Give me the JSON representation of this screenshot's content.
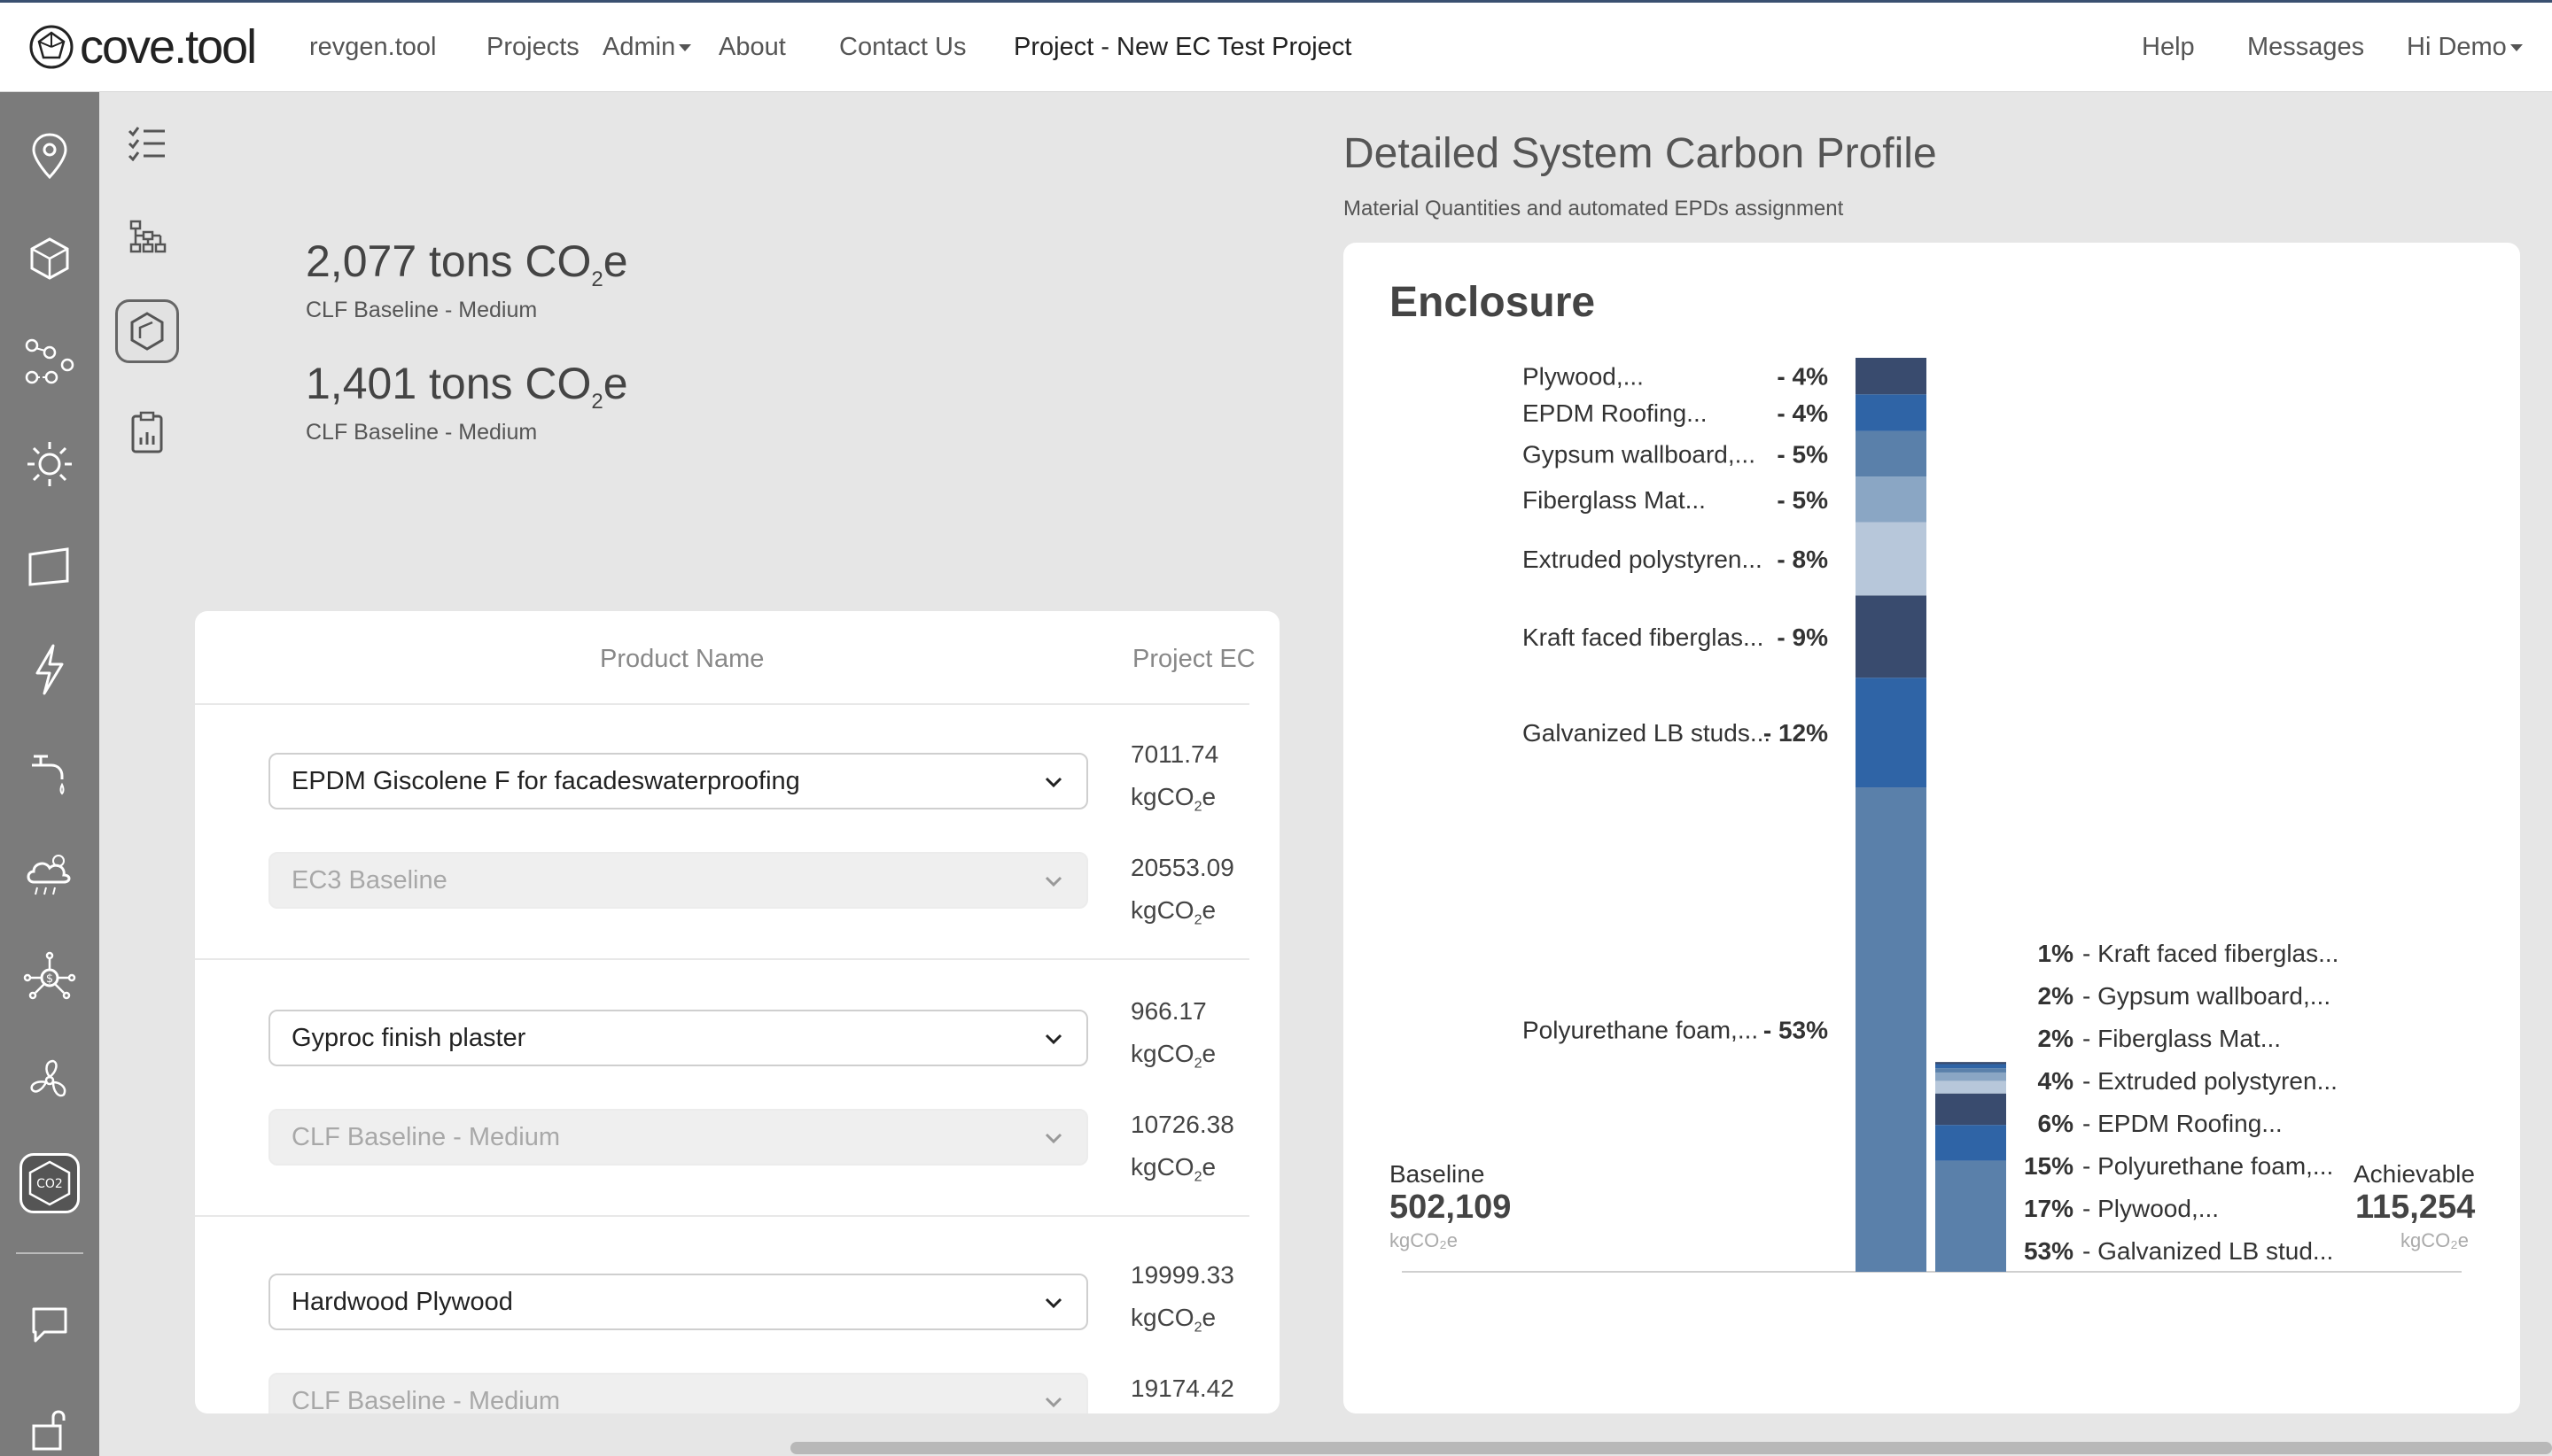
{
  "brand": {
    "logo_text": "cove.tool"
  },
  "nav": {
    "revgen": "revgen.tool",
    "projects": "Projects",
    "admin": "Admin",
    "about": "About",
    "contact": "Contact Us",
    "project_title": "Project - New EC Test Project",
    "help": "Help",
    "messages": "Messages",
    "user": "Hi Demo"
  },
  "sidebar": {
    "co2_label": "CO2"
  },
  "stats": [
    {
      "value": "2,077 tons CO",
      "sub": "2",
      "suffix": "e",
      "label": "CLF Baseline - Medium"
    },
    {
      "value": "1,401 tons CO",
      "sub": "2",
      "suffix": "e",
      "label": "CLF Baseline - Medium"
    }
  ],
  "table": {
    "col_product": "Product Name",
    "col_ec": "Project EC",
    "unit_prefix": "kgCO",
    "unit_sub": "2",
    "unit_suffix": "e",
    "rows": [
      {
        "product": "EPDM Giscolene F for facadeswaterproofing",
        "ec": "7011.74",
        "baseline": "EC3 Baseline",
        "baseline_ec": "20553.09"
      },
      {
        "product": "Gyproc finish plaster",
        "ec": "966.17",
        "baseline": "CLF Baseline - Medium",
        "baseline_ec": "10726.38"
      },
      {
        "product": "Hardwood Plywood",
        "ec": "19999.33",
        "baseline": "CLF Baseline - Medium",
        "baseline_ec": "19174.42"
      }
    ]
  },
  "profile": {
    "title": "Detailed System Carbon Profile",
    "subtitle": "Material Quantities and automated EPDs assignment",
    "card_title": "Enclosure",
    "baseline_label": "Baseline",
    "baseline_value": "502,109",
    "baseline_unit": "kgCO₂e",
    "achievable_label": "Achievable",
    "achievable_value": "115,254",
    "achievable_unit": "kgCO₂e"
  },
  "chart_data": {
    "type": "bar",
    "stacked": true,
    "categories": [
      "Baseline",
      "Achievable"
    ],
    "totals": [
      502109,
      115254
    ],
    "units": "kgCO₂e",
    "baseline_segments": [
      {
        "name": "Polyurethane foam,...",
        "pct": 53,
        "color": "#5a80aa"
      },
      {
        "name": "Galvanized LB studs...",
        "pct": 12,
        "color": "#2f64a6"
      },
      {
        "name": "Kraft faced fiberglas...",
        "pct": 9,
        "color": "#394b6e"
      },
      {
        "name": "Extruded polystyren...",
        "pct": 8,
        "color": "#b7c7da"
      },
      {
        "name": "Fiberglass Mat...",
        "pct": 5,
        "color": "#8aa6c4"
      },
      {
        "name": "Gypsum wallboard,...",
        "pct": 5,
        "color": "#5a80aa"
      },
      {
        "name": "EPDM Roofing...",
        "pct": 4,
        "color": "#2f64a6"
      },
      {
        "name": "Plywood,...",
        "pct": 4,
        "color": "#394b6e"
      }
    ],
    "achievable_segments": [
      {
        "name": "Galvanized LB stud...",
        "pct": 53,
        "color": "#5a80aa"
      },
      {
        "name": "Plywood,...",
        "pct": 17,
        "color": "#2f64a6"
      },
      {
        "name": "Polyurethane foam,...",
        "pct": 15,
        "color": "#394b6e"
      },
      {
        "name": "EPDM Roofing...",
        "pct": 6,
        "color": "#b7c7da"
      },
      {
        "name": "Extruded polystyren...",
        "pct": 4,
        "color": "#8aa6c4"
      },
      {
        "name": "Fiberglass Mat...",
        "pct": 2,
        "color": "#5a80aa"
      },
      {
        "name": "Gypsum wallboard,...",
        "pct": 2,
        "color": "#2f64a6"
      },
      {
        "name": "Kraft faced fiberglas...",
        "pct": 1,
        "color": "#394b6e"
      }
    ]
  }
}
